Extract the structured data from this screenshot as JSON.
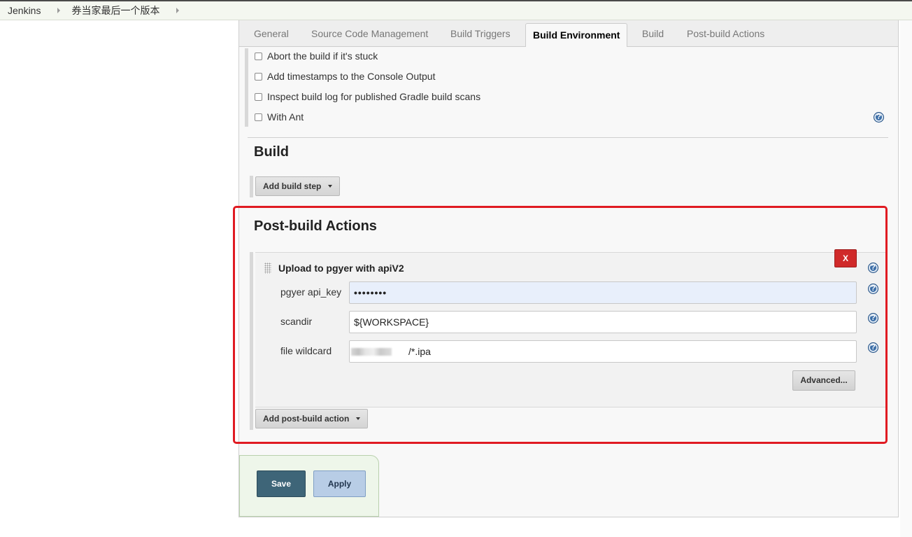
{
  "breadcrumb": {
    "items": [
      "Jenkins",
      "券当家最后一个版本"
    ]
  },
  "tabs": [
    {
      "label": "General"
    },
    {
      "label": "Source Code Management"
    },
    {
      "label": "Build Triggers"
    },
    {
      "label": "Build Environment",
      "active": true
    },
    {
      "label": "Build"
    },
    {
      "label": "Post-build Actions"
    }
  ],
  "build_environment": {
    "options": [
      {
        "label": "Abort the build if it's stuck",
        "checked": false
      },
      {
        "label": "Add timestamps to the Console Output",
        "checked": false
      },
      {
        "label": "Inspect build log for published Gradle build scans",
        "checked": false
      },
      {
        "label": "With Ant",
        "checked": false
      }
    ]
  },
  "build": {
    "title": "Build",
    "add_step_label": "Add build step"
  },
  "post_build": {
    "title": "Post-build Actions",
    "action_title": "Upload to pgyer with apiV2",
    "delete_label": "X",
    "fields": {
      "api_key": {
        "label": "pgyer api_key",
        "value": "••••••••"
      },
      "scandir": {
        "label": "scandir",
        "value": "${WORKSPACE}"
      },
      "file_wildcard": {
        "label": "file wildcard",
        "value_suffix": "/*.ipa"
      }
    },
    "advanced_label": "Advanced...",
    "add_action_label": "Add post-build action"
  },
  "form_actions": {
    "save_label": "Save",
    "apply_label": "Apply"
  },
  "icons": {
    "help": "help-icon",
    "caret": "chevron-down-icon",
    "drag": "drag-handle-icon"
  },
  "colors": {
    "highlight": "#e01b22",
    "save_button": "#3e6578",
    "apply_button": "#b8cde6",
    "delete_button": "#d02a2a",
    "help_icon": "#3d6fa8"
  }
}
